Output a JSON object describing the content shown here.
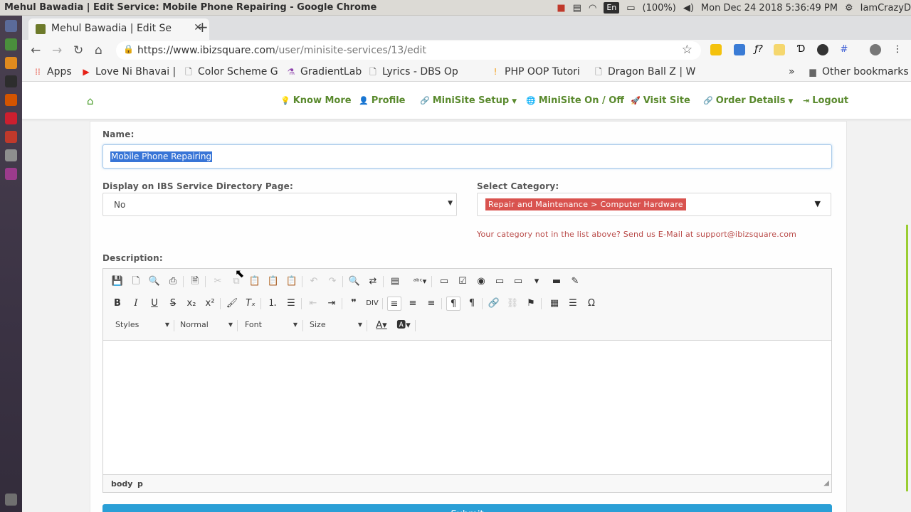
{
  "os": {
    "window_title": "Mehul Bawadia | Edit Service: Mobile Phone Repairing - Google Chrome",
    "language": "En",
    "battery": "(100%)",
    "datetime": "Mon Dec 24 2018  5:36:49 PM",
    "user": "IamCrazyD"
  },
  "browser": {
    "tab_title": "Mehul Bawadia | Edit Service",
    "url_host": "https://www.ibizsquare.com",
    "url_path": "/user/minisite-services/13/edit",
    "bookmarks": [
      {
        "label": "Apps",
        "icon": "apps-grid-icon"
      },
      {
        "label": "Love Ni Bhavai |",
        "icon": "youtube-icon"
      },
      {
        "label": "Color Scheme G",
        "icon": "page-icon"
      },
      {
        "label": "GradientLab",
        "icon": "flask-icon"
      },
      {
        "label": "Lyrics - DBS Op",
        "icon": "page-icon"
      },
      {
        "label": "PHP OOP Tutori",
        "icon": "orange-circle-icon"
      },
      {
        "label": "Dragon Ball Z | W",
        "icon": "page-icon"
      }
    ],
    "bookmarks_overflow": "»",
    "other_bookmarks": "Other bookmarks"
  },
  "nav": {
    "items": [
      {
        "label": "Know More",
        "icon": "lightbulb-icon",
        "dropdown": false
      },
      {
        "label": "Profile",
        "icon": "user-icon",
        "dropdown": false
      },
      {
        "label": "MiniSite Setup",
        "icon": "link-icon",
        "dropdown": true
      },
      {
        "label": "MiniSite On / Off",
        "icon": "globe-icon",
        "dropdown": false
      },
      {
        "label": "Visit Site",
        "icon": "rocket-icon",
        "dropdown": false
      },
      {
        "label": "Order Details",
        "icon": "link-icon",
        "dropdown": true
      },
      {
        "label": "Logout",
        "icon": "sign-out-icon",
        "dropdown": false
      }
    ]
  },
  "form": {
    "name_label": "Name:",
    "name_value": "Mobile Phone Repairing",
    "display_label": "Display on IBS Service Directory Page:",
    "display_value": "No",
    "category_label": "Select Category:",
    "category_value": "Repair and Maintenance > Computer Hardware",
    "category_note": "Your category not in the list above? Send us E-Mail at support@ibizsquare.com",
    "description_label": "Description:",
    "editor": {
      "combo_styles": "Styles",
      "combo_format": "Normal",
      "combo_font": "Font",
      "combo_size": "Size",
      "path_body": "body",
      "path_p": "p"
    },
    "submit_label": "Submit"
  },
  "colors": {
    "nav_green": "#5a8a2e",
    "category_tag": "#d9534f",
    "note_red": "#b94a48",
    "submit_blue": "#2a9fd6",
    "selection_blue": "#3875d7"
  }
}
